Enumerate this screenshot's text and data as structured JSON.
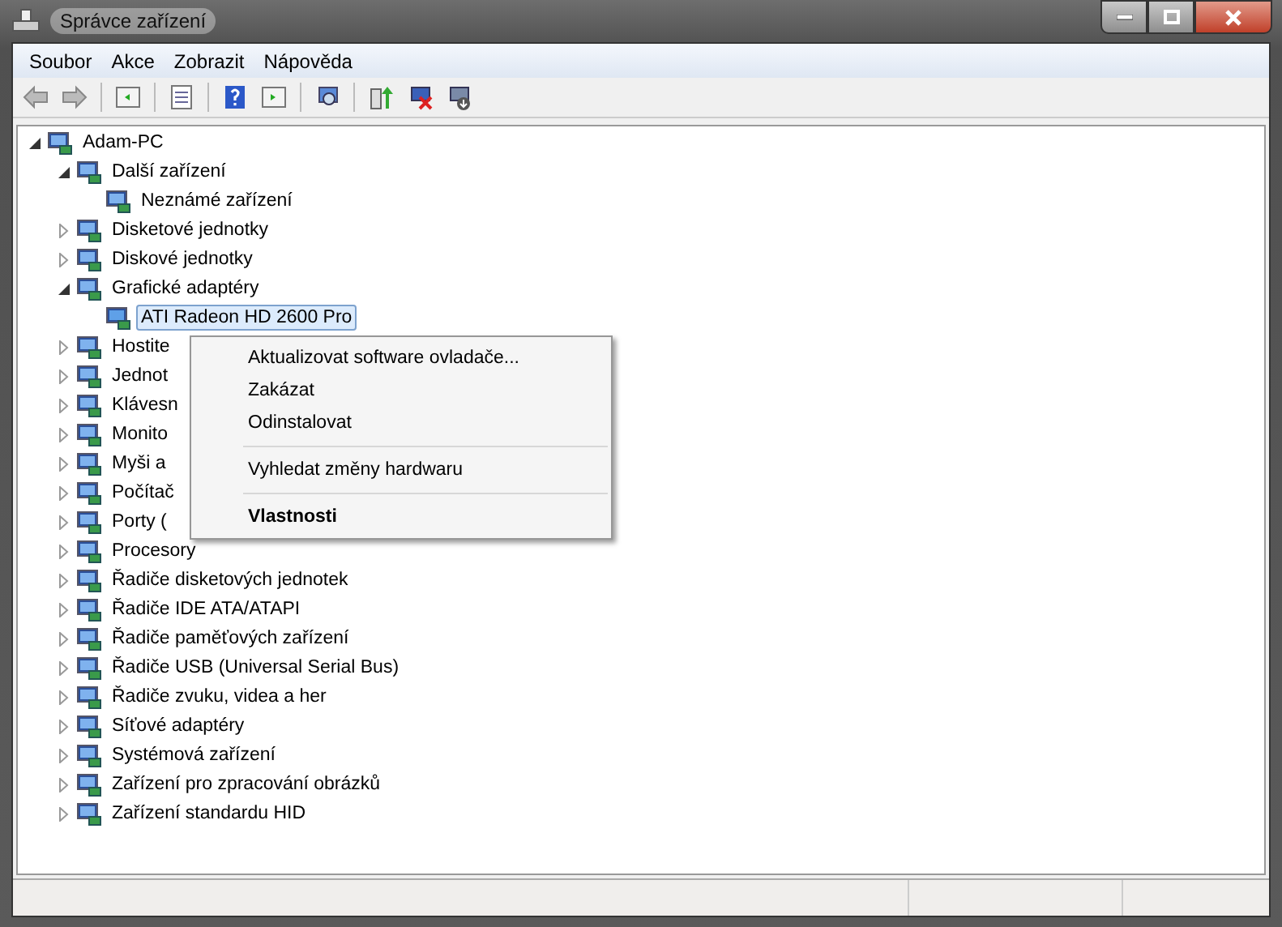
{
  "window": {
    "title": "Správce zařízení"
  },
  "menu_bar": [
    "Soubor",
    "Akce",
    "Zobrazit",
    "Nápověda"
  ],
  "tree": [
    {
      "label": "Adam-PC",
      "expanded": true,
      "selected": false,
      "children": [
        {
          "label": "Další zařízení",
          "expanded": true,
          "selected": false,
          "children": [
            {
              "label": "Neznámé zařízení",
              "selected": false
            }
          ]
        },
        {
          "label": "Disketové jednotky",
          "expanded": false,
          "selected": false
        },
        {
          "label": "Diskové jednotky",
          "expanded": false,
          "selected": false
        },
        {
          "label": "Grafické adaptéry",
          "expanded": true,
          "selected": false,
          "children": [
            {
              "label": "ATI Radeon HD 2600 Pro",
              "selected": true
            }
          ]
        },
        {
          "label": "Hostite",
          "expanded": false,
          "selected": false
        },
        {
          "label": "Jednot",
          "expanded": false,
          "selected": false
        },
        {
          "label": "Klávesn",
          "expanded": false,
          "selected": false
        },
        {
          "label": "Monito",
          "expanded": false,
          "selected": false
        },
        {
          "label": "Myši a",
          "expanded": false,
          "selected": false
        },
        {
          "label": "Počítač",
          "expanded": false,
          "selected": false
        },
        {
          "label": "Porty (",
          "expanded": false,
          "selected": false
        },
        {
          "label": "Procesory",
          "expanded": false,
          "selected": false
        },
        {
          "label": "Řadiče disketových jednotek",
          "expanded": false,
          "selected": false
        },
        {
          "label": "Řadiče IDE ATA/ATAPI",
          "expanded": false,
          "selected": false
        },
        {
          "label": "Řadiče paměťových zařízení",
          "expanded": false,
          "selected": false
        },
        {
          "label": "Řadiče USB (Universal Serial Bus)",
          "expanded": false,
          "selected": false
        },
        {
          "label": "Řadiče zvuku, videa a her",
          "expanded": false,
          "selected": false
        },
        {
          "label": "Síťové adaptéry",
          "expanded": false,
          "selected": false
        },
        {
          "label": "Systémová zařízení",
          "expanded": false,
          "selected": false
        },
        {
          "label": "Zařízení pro zpracování obrázků",
          "expanded": false,
          "selected": false
        },
        {
          "label": "Zařízení standardu HID",
          "expanded": false,
          "selected": false
        }
      ]
    }
  ],
  "context_menu": [
    {
      "kind": "item",
      "label": "Aktualizovat software ovladače...",
      "default": false
    },
    {
      "kind": "item",
      "label": "Zakázat",
      "default": false
    },
    {
      "kind": "item",
      "label": "Odinstalovat",
      "default": false
    },
    {
      "kind": "separator"
    },
    {
      "kind": "item",
      "label": "Vyhledat změny hardwaru",
      "default": false
    },
    {
      "kind": "separator"
    },
    {
      "kind": "item",
      "label": "Vlastnosti",
      "default": true
    }
  ]
}
